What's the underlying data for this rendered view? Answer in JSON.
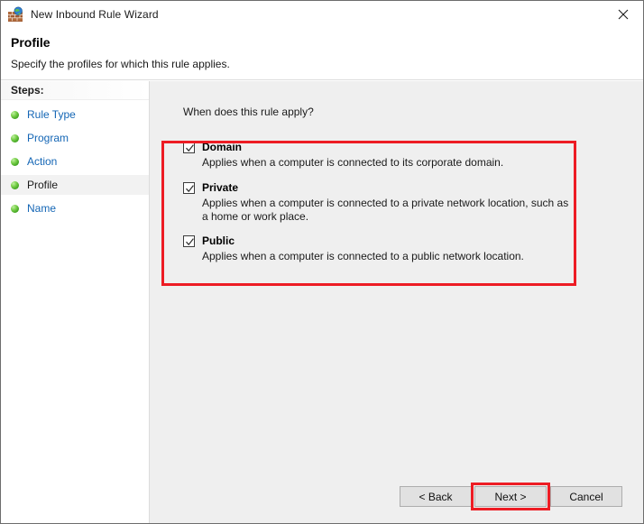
{
  "window": {
    "title": "New Inbound Rule Wizard",
    "app_icon": "firewall-globe-icon",
    "close_label": "Close"
  },
  "header": {
    "title": "Profile",
    "subtitle": "Specify the profiles for which this rule applies."
  },
  "sidebar": {
    "header": "Steps:",
    "items": [
      {
        "label": "Rule Type",
        "current": false
      },
      {
        "label": "Program",
        "current": false
      },
      {
        "label": "Action",
        "current": false
      },
      {
        "label": "Profile",
        "current": true
      },
      {
        "label": "Name",
        "current": false
      }
    ]
  },
  "content": {
    "question": "When does this rule apply?",
    "options": [
      {
        "label": "Domain",
        "checked": true,
        "description": "Applies when a computer is connected to its corporate domain."
      },
      {
        "label": "Private",
        "checked": true,
        "description": "Applies when a computer is connected to a private network location, such as a home or work place."
      },
      {
        "label": "Public",
        "checked": true,
        "description": "Applies when a computer is connected to a public network location."
      }
    ]
  },
  "footer": {
    "back_label": "< Back",
    "next_label": "Next >",
    "cancel_label": "Cancel"
  },
  "annotations": {
    "color": "#ed1c24",
    "highlight_options": true,
    "highlight_next_button": true
  }
}
